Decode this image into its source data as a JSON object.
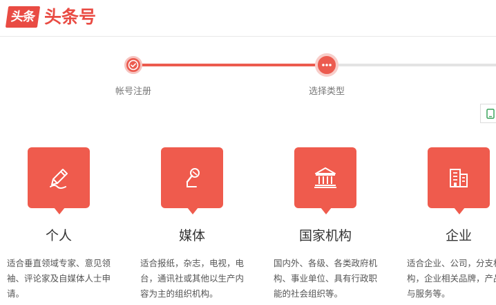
{
  "header": {
    "logo_badge": "头条",
    "logo_text": "头条号"
  },
  "stepper": {
    "steps": [
      {
        "label": "帐号注册",
        "state": "done"
      },
      {
        "label": "选择类型",
        "state": "current"
      }
    ],
    "progress_fraction": 0.5
  },
  "side_tool": {
    "icon": "tablet-icon"
  },
  "colors": {
    "brand_red": "#ef5b4d",
    "logo_red": "#e94b43",
    "track_gray": "#e3e3e3"
  },
  "account_types": [
    {
      "title": "个人",
      "icon": "pencil-icon",
      "description": "适合垂直领域专家、意见领袖、评论家及自媒体人士申请。"
    },
    {
      "title": "媒体",
      "icon": "microphone-icon",
      "description": "适合报纸，杂志，电视，电台，通讯社或其他以生产内容为主的组织机构。"
    },
    {
      "title": "国家机构",
      "icon": "government-building-icon",
      "description": "国内外、各级、各类政府机构、事业单位、具有行政职能的社会组织等。"
    },
    {
      "title": "企业",
      "icon": "office-building-icon",
      "description": "适合企业、公司，分支机构，企业相关品牌，产品与服务等。"
    }
  ]
}
